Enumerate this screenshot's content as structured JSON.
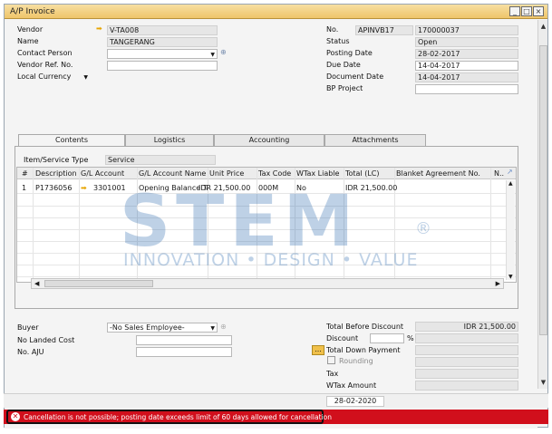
{
  "window": {
    "title": "A/P Invoice"
  },
  "header_left": {
    "vendor_label": "Vendor",
    "vendor_value": "V-TA008",
    "name_label": "Name",
    "name_value": "TANGERANG",
    "contact_label": "Contact Person",
    "contact_value": "",
    "refno_label": "Vendor Ref. No.",
    "refno_value": "",
    "currency_label": "Local Currency"
  },
  "header_right": {
    "no_label": "No.",
    "series_value": "APINVB17",
    "no_value": "170000037",
    "status_label": "Status",
    "status_value": "Open",
    "posting_label": "Posting Date",
    "posting_value": "28-02-2017",
    "due_label": "Due Date",
    "due_value": "14-04-2017",
    "docdate_label": "Document Date",
    "docdate_value": "14-04-2017",
    "bpproject_label": "BP Project",
    "bpproject_value": ""
  },
  "tabs": [
    "Contents",
    "Logistics",
    "Accounting",
    "Attachments"
  ],
  "contents": {
    "item_service_label": "Item/Service Type",
    "item_service_value": "Service",
    "columns": [
      "#",
      "Description",
      "G/L Account",
      "G/L Account Name",
      "Unit Price",
      "Tax Code",
      "WTax Liable",
      "Total (LC)",
      "Blanket Agreement No.",
      "N.."
    ],
    "rows": [
      {
        "num": "1",
        "description": "P1736056",
        "gl_account": "3301001",
        "gl_name": "Opening Balance Tal",
        "unit_price": "IDR 21,500.00",
        "tax_code": "000M",
        "wtax": "No",
        "total": "IDR 21,500.00",
        "blanket": "",
        "n": ""
      }
    ]
  },
  "footer_left": {
    "buyer_label": "Buyer",
    "buyer_value": "-No Sales Employee-",
    "landed_label": "No Landed Cost",
    "landed_value": "",
    "aju_label": "No. AJU",
    "aju_value": ""
  },
  "footer_right": {
    "total_before_label": "Total Before Discount",
    "total_before_value": "IDR 21,500.00",
    "discount_label": "Discount",
    "discount_pct": "%",
    "down_payment_label": "Total Down Payment",
    "down_payment_btn": "...",
    "rounding_label": "Rounding",
    "tax_label": "Tax",
    "wtax_label": "WTax Amount"
  },
  "status_date": "28-02-2020",
  "error_message": "Cancellation is not possible; posting date exceeds limit of 60 days allowed for cancellation",
  "watermark": {
    "big": "STEM",
    "small": "INNOVATION  •  DESIGN  •  VALUE",
    "reg": "®"
  },
  "colors": {
    "error_bar": "#d10f1c",
    "titlebar": "#efc56a",
    "link_arrow": "#e7a400"
  }
}
